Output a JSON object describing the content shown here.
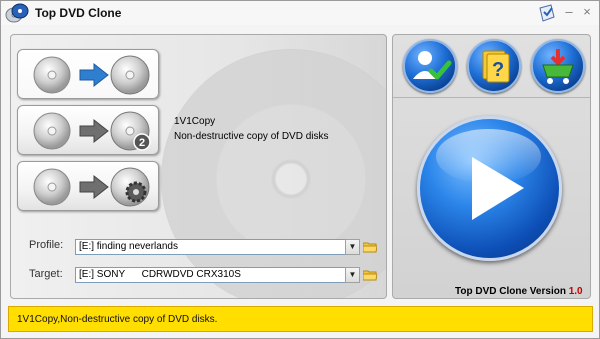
{
  "window": {
    "title": "Top DVD Clone"
  },
  "titlebar": {
    "skin_icon": "skin-icon",
    "minimize": "–",
    "close": "×"
  },
  "modes": [
    {
      "name": "1V1Copy",
      "icon": "disc-to-disc",
      "selected": true
    },
    {
      "name": "1V2Copy",
      "icon": "disc-to-disc-2",
      "selected": false
    },
    {
      "name": "Custom",
      "icon": "disc-to-gear",
      "selected": false
    }
  ],
  "description": {
    "title": "1V1Copy",
    "text": "Non-destructive copy of DVD disks"
  },
  "fields": {
    "profile": {
      "label": "Profile:",
      "value": "[E:] finding neverlands"
    },
    "target": {
      "label": "Target:",
      "value": "[E:] SONY      CDRWDVD CRX310S"
    }
  },
  "right_panel": {
    "buttons": [
      "register-icon",
      "help-icon",
      "buy-icon"
    ],
    "play": "play-icon",
    "version_label": "Top DVD Clone Version",
    "version_number": "1.0"
  },
  "status": {
    "text": "1V1Copy,Non-destructive copy of DVD disks."
  },
  "colors": {
    "accent_blue": "#1f6fd6",
    "status_yellow": "#ffde00",
    "version_red": "#c00000"
  }
}
